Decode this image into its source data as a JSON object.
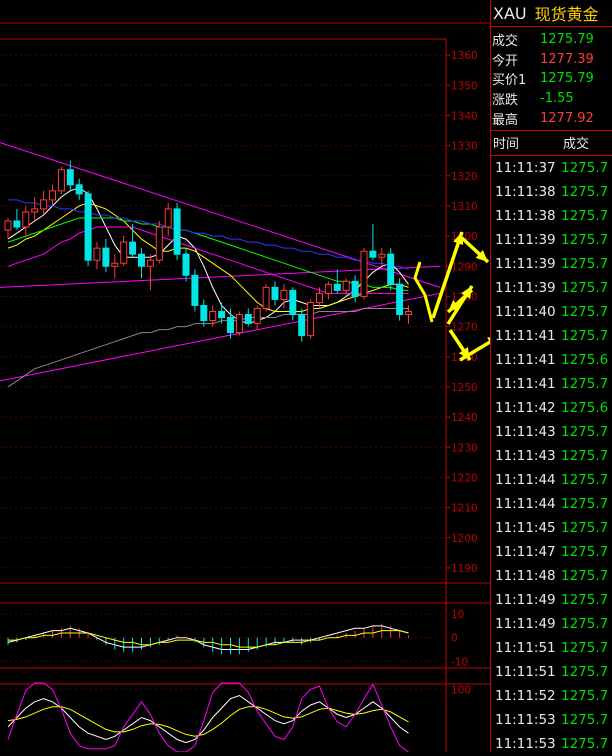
{
  "panel": {
    "symbol": "XAU",
    "name": "现货黄金",
    "quotes": [
      {
        "label": "成交",
        "value": "1275.79",
        "color": "#00e000"
      },
      {
        "label": "今开",
        "value": "1277.39",
        "color": "#ff3b3b"
      },
      {
        "label": "买价1",
        "value": "1275.79",
        "color": "#00e000"
      },
      {
        "label": "涨跌",
        "value": "-1.55",
        "color": "#00e000"
      },
      {
        "label": "最高",
        "value": "1277.92",
        "color": "#ff3b3b"
      }
    ],
    "tick_headers": {
      "time": "时间",
      "price": "成交"
    },
    "ticks": [
      {
        "time": "11:11:37",
        "price": "1275.7"
      },
      {
        "time": "11:11:38",
        "price": "1275.7"
      },
      {
        "time": "11:11:38",
        "price": "1275.7"
      },
      {
        "time": "11:11:39",
        "price": "1275.7"
      },
      {
        "time": "11:11:39",
        "price": "1275.7"
      },
      {
        "time": "11:11:39",
        "price": "1275.7"
      },
      {
        "time": "11:11:40",
        "price": "1275.7"
      },
      {
        "time": "11:11:41",
        "price": "1275.7"
      },
      {
        "time": "11:11:41",
        "price": "1275.6"
      },
      {
        "time": "11:11:41",
        "price": "1275.7"
      },
      {
        "time": "11:11:42",
        "price": "1275.6"
      },
      {
        "time": "11:11:43",
        "price": "1275.7"
      },
      {
        "time": "11:11:43",
        "price": "1275.7"
      },
      {
        "time": "11:11:44",
        "price": "1275.7"
      },
      {
        "time": "11:11:44",
        "price": "1275.7"
      },
      {
        "time": "11:11:45",
        "price": "1275.7"
      },
      {
        "time": "11:11:47",
        "price": "1275.7"
      },
      {
        "time": "11:11:48",
        "price": "1275.7"
      },
      {
        "time": "11:11:49",
        "price": "1275.7"
      },
      {
        "time": "11:11:49",
        "price": "1275.7"
      },
      {
        "time": "11:11:51",
        "price": "1275.7"
      },
      {
        "time": "11:11:51",
        "price": "1275.7"
      },
      {
        "time": "11:11:52",
        "price": "1275.7"
      },
      {
        "time": "11:11:53",
        "price": "1275.7"
      },
      {
        "time": "11:11:53",
        "price": "1275.7"
      }
    ]
  },
  "colors": {
    "up": "#ff3b3b",
    "down": "#00e5e5",
    "axis": "#c00000",
    "grid": "#500000",
    "annotation": "#ffff00"
  },
  "chart_data": {
    "type": "candlestick",
    "main": {
      "ylim": [
        1185,
        1365
      ],
      "yticks": [
        1190,
        1200,
        1210,
        1220,
        1230,
        1240,
        1250,
        1260,
        1270,
        1280,
        1290,
        1300,
        1310,
        1320,
        1330,
        1340,
        1350,
        1360
      ],
      "ohlc": [
        [
          1302,
          1306,
          1299,
          1305
        ],
        [
          1305,
          1309,
          1302,
          1303
        ],
        [
          1303,
          1310,
          1300,
          1308
        ],
        [
          1308,
          1313,
          1305,
          1309
        ],
        [
          1309,
          1315,
          1307,
          1312
        ],
        [
          1312,
          1317,
          1310,
          1315
        ],
        [
          1315,
          1323,
          1314,
          1322
        ],
        [
          1322,
          1325,
          1315,
          1317
        ],
        [
          1317,
          1319,
          1312,
          1314
        ],
        [
          1314,
          1315,
          1290,
          1292
        ],
        [
          1292,
          1298,
          1289,
          1296
        ],
        [
          1296,
          1299,
          1288,
          1290
        ],
        [
          1290,
          1294,
          1286,
          1291
        ],
        [
          1291,
          1300,
          1290,
          1298
        ],
        [
          1298,
          1304,
          1293,
          1294
        ],
        [
          1294,
          1296,
          1286,
          1290
        ],
        [
          1290,
          1294,
          1282,
          1292
        ],
        [
          1292,
          1305,
          1291,
          1303
        ],
        [
          1303,
          1311,
          1300,
          1309
        ],
        [
          1309,
          1311,
          1292,
          1294
        ],
        [
          1294,
          1296,
          1285,
          1287
        ],
        [
          1287,
          1289,
          1275,
          1277
        ],
        [
          1277,
          1279,
          1270,
          1272
        ],
        [
          1272,
          1277,
          1270,
          1275
        ],
        [
          1275,
          1278,
          1271,
          1273
        ],
        [
          1273,
          1276,
          1266,
          1268
        ],
        [
          1268,
          1275,
          1267,
          1274
        ],
        [
          1274,
          1276,
          1270,
          1271
        ],
        [
          1271,
          1277,
          1269,
          1276
        ],
        [
          1276,
          1284,
          1275,
          1283
        ],
        [
          1283,
          1285,
          1277,
          1279
        ],
        [
          1279,
          1284,
          1276,
          1282
        ],
        [
          1282,
          1283,
          1272,
          1274
        ],
        [
          1274,
          1276,
          1265,
          1267
        ],
        [
          1267,
          1279,
          1266,
          1278
        ],
        [
          1278,
          1283,
          1276,
          1281
        ],
        [
          1281,
          1285,
          1279,
          1284
        ],
        [
          1284,
          1289,
          1281,
          1282
        ],
        [
          1282,
          1286,
          1280,
          1285
        ],
        [
          1285,
          1287,
          1278,
          1280
        ],
        [
          1280,
          1296,
          1279,
          1295
        ],
        [
          1295,
          1304,
          1292,
          1293
        ],
        [
          1293,
          1296,
          1290,
          1294
        ],
        [
          1294,
          1296,
          1282,
          1284
        ],
        [
          1284,
          1286,
          1272,
          1274
        ],
        [
          1274,
          1277,
          1271,
          1275
        ]
      ],
      "ma": [
        {
          "name": "MA5",
          "color": "#ffffff",
          "values": [
            1299,
            1301,
            1303,
            1305,
            1307,
            1310,
            1313,
            1315,
            1316,
            1314,
            1309,
            1303,
            1297,
            1293,
            1293,
            1293,
            1293,
            1294,
            1297,
            1300,
            1299,
            1296,
            1290,
            1283,
            1277,
            1274,
            1272,
            1271,
            1272,
            1273,
            1275,
            1278,
            1279,
            1278,
            1277,
            1277,
            1277,
            1278,
            1280,
            1282,
            1285,
            1288,
            1290,
            1291,
            1288,
            1284
          ]
        },
        {
          "name": "MA10",
          "color": "#ffff00",
          "values": [
            1296,
            1297,
            1299,
            1300,
            1302,
            1304,
            1306,
            1308,
            1310,
            1311,
            1310,
            1309,
            1307,
            1305,
            1302,
            1299,
            1297,
            1295,
            1295,
            1296,
            1296,
            1295,
            1293,
            1291,
            1289,
            1287,
            1284,
            1281,
            1278,
            1276,
            1275,
            1275,
            1275,
            1275,
            1276,
            1276,
            1277,
            1278,
            1279,
            1280,
            1281,
            1282,
            1283,
            1284,
            1284,
            1283
          ]
        },
        {
          "name": "MA20",
          "color": "#ff00ff",
          "values": [
            1290,
            1291,
            1292,
            1293,
            1294,
            1296,
            1298,
            1299,
            1301,
            1302,
            1303,
            1303,
            1303,
            1303,
            1303,
            1302,
            1301,
            1300,
            1299,
            1298,
            1297,
            1296,
            1295,
            1294,
            1293,
            1292,
            1291,
            1290,
            1289,
            1288,
            1287,
            1286,
            1285,
            1284,
            1283,
            1282,
            1281,
            1281,
            1281,
            1281,
            1281,
            1281,
            1281,
            1281,
            1281,
            1281
          ]
        },
        {
          "name": "MA30",
          "color": "#00ff00",
          "values": [
            1298,
            1299,
            1300,
            1301,
            1302,
            1303,
            1304,
            1305,
            1306,
            1306,
            1306,
            1306,
            1306,
            1305,
            1305,
            1304,
            1304,
            1303,
            1303,
            1302,
            1302,
            1301,
            1300,
            1299,
            1298,
            1297,
            1296,
            1295,
            1294,
            1293,
            1292,
            1291,
            1290,
            1289,
            1288,
            1287,
            1286,
            1285,
            1285,
            1284,
            1284,
            1283,
            1283,
            1283,
            1282,
            1282
          ]
        },
        {
          "name": "MA60",
          "color": "#3333ff",
          "values": [
            1312,
            1312,
            1311,
            1311,
            1310,
            1310,
            1309,
            1309,
            1308,
            1308,
            1307,
            1307,
            1306,
            1306,
            1305,
            1305,
            1304,
            1304,
            1303,
            1302,
            1302,
            1301,
            1301,
            1300,
            1300,
            1299,
            1299,
            1298,
            1298,
            1297,
            1297,
            1296,
            1296,
            1295,
            1295,
            1294,
            1294,
            1293,
            1293,
            1292,
            1292,
            1291,
            1291,
            1290,
            1290,
            1289
          ]
        },
        {
          "name": "MA120",
          "color": "#888888",
          "values": [
            1250,
            1252,
            1254,
            1256,
            1257,
            1258,
            1259,
            1260,
            1261,
            1262,
            1263,
            1264,
            1265,
            1266,
            1267,
            1268,
            1268,
            1269,
            1269,
            1270,
            1270,
            1271,
            1271,
            1271,
            1272,
            1272,
            1272,
            1273,
            1273,
            1273,
            1273,
            1274,
            1274,
            1274,
            1274,
            1275,
            1275,
            1275,
            1275,
            1275,
            1276,
            1276,
            1276,
            1276,
            1276,
            1276
          ]
        }
      ]
    },
    "macd": {
      "ylim": [
        -12,
        16
      ],
      "yticks": [
        -10,
        0,
        10
      ],
      "hist": [
        -3,
        -2,
        -1,
        1,
        2,
        3,
        4,
        5,
        4,
        2,
        -1,
        -3,
        -5,
        -6,
        -6,
        -5,
        -4,
        -3,
        -1,
        1,
        0,
        -2,
        -4,
        -6,
        -7,
        -7,
        -7,
        -6,
        -5,
        -4,
        -3,
        -2,
        -2,
        -3,
        -2,
        -1,
        0,
        1,
        2,
        3,
        4,
        5,
        6,
        5,
        3,
        1
      ],
      "dif": [
        -2,
        -1,
        0,
        1,
        2,
        3,
        3,
        4,
        3,
        2,
        0,
        -2,
        -3,
        -4,
        -4,
        -4,
        -3,
        -2,
        -1,
        0,
        0,
        -1,
        -3,
        -4,
        -5,
        -5,
        -5,
        -5,
        -4,
        -3,
        -2,
        -2,
        -1,
        -1,
        -1,
        0,
        1,
        2,
        3,
        4,
        4,
        5,
        5,
        4,
        3,
        2
      ],
      "dea": [
        -1,
        -1,
        0,
        0,
        1,
        1,
        2,
        2,
        2,
        2,
        1,
        0,
        -1,
        -2,
        -2,
        -3,
        -3,
        -2,
        -2,
        -1,
        -1,
        -1,
        -2,
        -2,
        -3,
        -3,
        -4,
        -4,
        -4,
        -3,
        -3,
        -2,
        -2,
        -2,
        -1,
        -1,
        0,
        0,
        1,
        1,
        2,
        2,
        3,
        3,
        3,
        2
      ]
    },
    "kdj": {
      "ylim": [
        0,
        110
      ],
      "yticks": [
        100
      ],
      "k": [
        40,
        55,
        70,
        80,
        85,
        80,
        70,
        55,
        40,
        30,
        25,
        20,
        25,
        35,
        45,
        55,
        50,
        40,
        30,
        20,
        15,
        20,
        35,
        55,
        70,
        85,
        90,
        80,
        70,
        60,
        50,
        45,
        50,
        65,
        75,
        80,
        70,
        60,
        55,
        60,
        70,
        80,
        70,
        55,
        40,
        30
      ],
      "d": [
        50,
        52,
        56,
        62,
        68,
        72,
        72,
        68,
        60,
        52,
        44,
        36,
        32,
        32,
        36,
        42,
        45,
        44,
        40,
        34,
        28,
        25,
        28,
        36,
        46,
        58,
        68,
        72,
        72,
        68,
        62,
        56,
        54,
        56,
        62,
        68,
        70,
        66,
        62,
        60,
        62,
        66,
        68,
        64,
        56,
        48
      ],
      "j": [
        20,
        60,
        98,
        110,
        110,
        100,
        68,
        30,
        10,
        5,
        5,
        5,
        10,
        40,
        60,
        80,
        60,
        30,
        10,
        0,
        0,
        10,
        50,
        95,
        110,
        110,
        110,
        95,
        65,
        45,
        25,
        20,
        40,
        85,
        100,
        105,
        70,
        48,
        40,
        60,
        85,
        108,
        75,
        40,
        10,
        0
      ]
    }
  }
}
